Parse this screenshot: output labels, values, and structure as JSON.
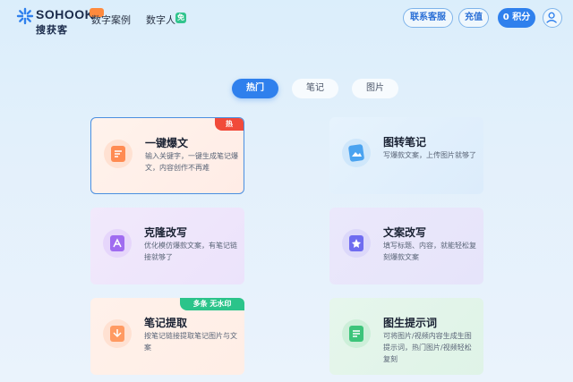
{
  "header": {
    "logo_word": "SOHOOK",
    "logo_cn": "搜获客",
    "nav": {
      "cases": "数字案例",
      "digital_human": "数字人",
      "digital_tag": "免"
    },
    "buttons": {
      "service": "联系客服",
      "recharge": "充值",
      "points": "0 积分"
    }
  },
  "tabs": [
    {
      "label": "热门"
    },
    {
      "label": "笔记"
    },
    {
      "label": "图片"
    }
  ],
  "cards": [
    {
      "title": "一键爆文",
      "desc": "输入关键字，一键生成笔记爆文，内容创作不再难",
      "badge": "热",
      "icon": "document-icon"
    },
    {
      "title": "图转笔记",
      "desc": "写爆款文案，上传图片就够了",
      "icon": "image-note-icon"
    },
    {
      "title": "克隆改写",
      "desc": "优化模仿爆款文案，有笔记链接就够了",
      "icon": "clone-icon"
    },
    {
      "title": "文案改写",
      "desc": "填写标题、内容，就能轻松复刻爆款文案",
      "icon": "rewrite-icon"
    },
    {
      "title": "笔记提取",
      "desc": "按笔记链接提取笔记图片与文案",
      "badge": "多条   无水印",
      "icon": "extract-icon"
    },
    {
      "title": "图生提示词",
      "desc": "可将图片/视频内容生成生图提示词，热门图片/视频轻松复刻",
      "icon": "prompt-icon"
    }
  ],
  "colors": {
    "accent": "#2f80ed",
    "hot": "#f14a3a",
    "green": "#2bc48a"
  }
}
